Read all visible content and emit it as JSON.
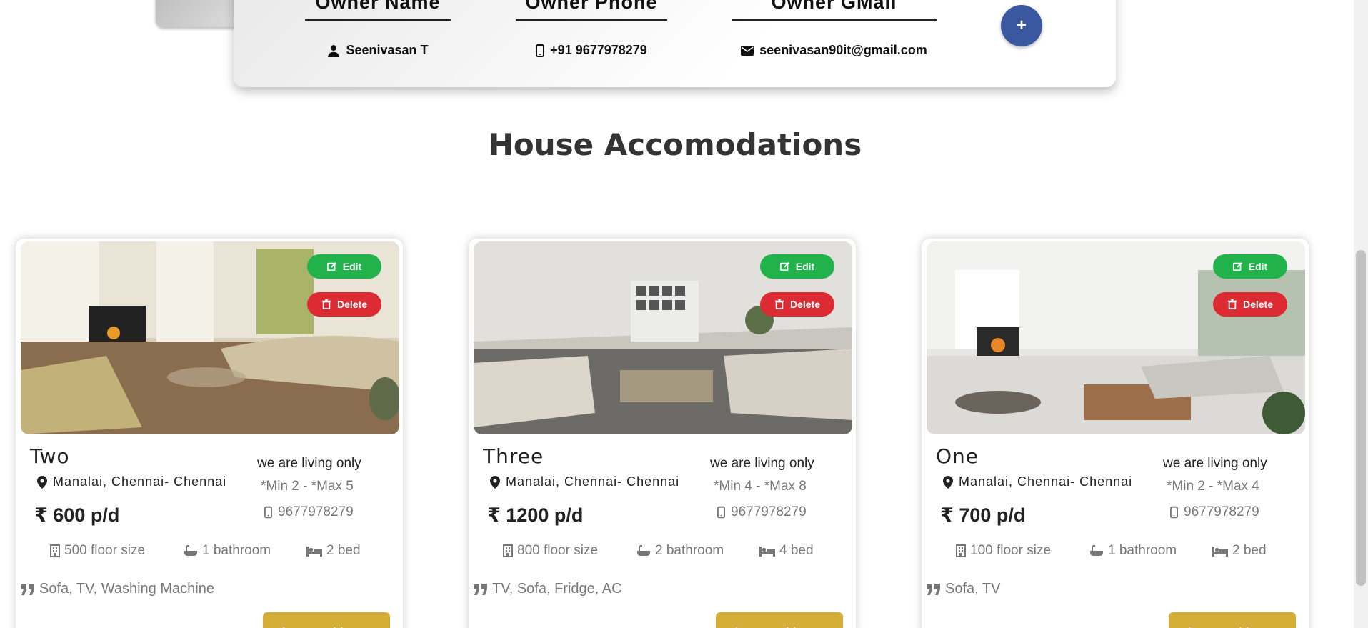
{
  "owner": {
    "name_header": "Owner Name",
    "phone_header": "Owner Phone",
    "email_header": "Owner GMail",
    "name": "Seenivasan T",
    "phone": "+91 9677978279",
    "email": "seenivasan90it@gmail.com",
    "add_label": "+"
  },
  "section_title": "House Accomodations",
  "houses": [
    {
      "name": "Two",
      "location": "Manalai, Chennai- Chennai",
      "price": "₹ 600 p/d",
      "living": "we are living only",
      "minmax": "*Min 2 - *Max 5",
      "phone": "9677978279",
      "floor": "500 floor size",
      "bathroom": "1 bathroom",
      "bed": "2 bed",
      "amenities": "Sofa, TV, Washing Machine",
      "edit_label": "Edit",
      "delete_label": "Delete",
      "view_label": "View Bookings"
    },
    {
      "name": "Three",
      "location": "Manalai, Chennai- Chennai",
      "price": "₹ 1200 p/d",
      "living": "we are living only",
      "minmax": "*Min 4 - *Max 8",
      "phone": "9677978279",
      "floor": "800 floor size",
      "bathroom": "2 bathroom",
      "bed": "4 bed",
      "amenities": "TV, Sofa, Fridge, AC",
      "edit_label": "Edit",
      "delete_label": "Delete",
      "view_label": "View Bookings"
    },
    {
      "name": "One",
      "location": "Manalai, Chennai- Chennai",
      "price": "₹ 700 p/d",
      "living": "we are living only",
      "minmax": "*Min 2 - *Max 4",
      "phone": "9677978279",
      "floor": "100 floor size",
      "bathroom": "1 bathroom",
      "bed": "2 bed",
      "amenities": "Sofa, TV",
      "edit_label": "Edit",
      "delete_label": "Delete",
      "view_label": "View Bookings"
    }
  ],
  "colors": {
    "edit": "#22b24c",
    "delete": "#dc2b33",
    "view": "#d4ae36",
    "add": "#3a58a0"
  }
}
